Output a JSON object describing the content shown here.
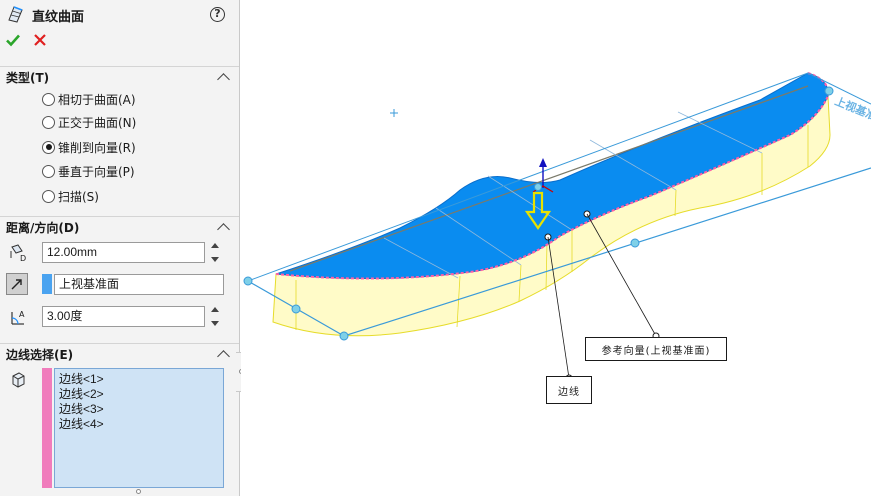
{
  "panel": {
    "title": "直纹曲面",
    "help_label": "?",
    "sections": {
      "type": {
        "header": "类型(T)",
        "options": [
          {
            "label": "相切于曲面(A)",
            "selected": false
          },
          {
            "label": "正交于曲面(N)",
            "selected": false
          },
          {
            "label": "锥削到向量(R)",
            "selected": true
          },
          {
            "label": "垂直于向量(P)",
            "selected": false
          },
          {
            "label": "扫描(S)",
            "selected": false
          }
        ]
      },
      "distance": {
        "header": "距离/方向(D)",
        "distance_value": "12.00mm",
        "reference_value": "上视基准面",
        "angle_value": "3.00度"
      },
      "edges": {
        "header": "边线选择(E)",
        "items": [
          "边线<1>",
          "边线<2>",
          "边线<3>",
          "边线<4>"
        ]
      }
    }
  },
  "viewport": {
    "callouts": {
      "edge": "边线",
      "reference": "参考向量(上视基准面)"
    },
    "plane_label": "上视基准面"
  },
  "colors": {
    "accent_blue": "#1e90ff",
    "surface_face": "#0a8cf0",
    "ruled_surface": "#fffbc8",
    "edge_pink": "#ff5fa8",
    "plane_line": "#3a9ad9",
    "arrow_yellow": "#e8e200",
    "ok_green": "#2aa52a",
    "cancel_red": "#e02020"
  },
  "icons": {
    "title": "ruled-surface-icon",
    "distance": "distance-icon",
    "reference": "reference-vector-icon",
    "angle": "angle-icon",
    "edges": "edge-selection-icon"
  }
}
